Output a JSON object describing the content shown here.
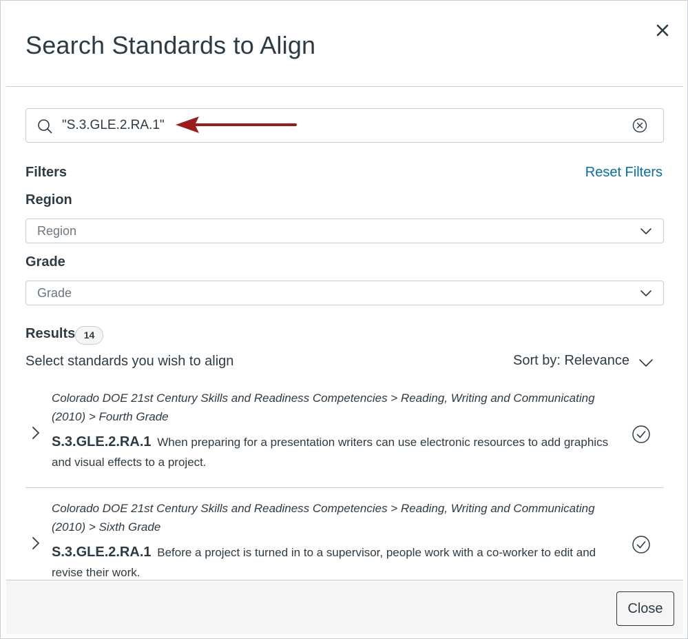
{
  "modal": {
    "title": "Search Standards to Align",
    "close_icon": "close-icon"
  },
  "search": {
    "value": "\"S.3.GLE.2.RA.1\"",
    "icon": "search-icon",
    "clear_icon": "clear-circle-icon"
  },
  "annotation": {
    "arrow_color": "#9b1c1c"
  },
  "filters": {
    "label": "Filters",
    "reset_label": "Reset Filters",
    "region": {
      "label": "Region",
      "placeholder": "Region"
    },
    "grade": {
      "label": "Grade",
      "placeholder": "Grade"
    }
  },
  "results": {
    "label": "Results",
    "count": "14",
    "hint": "Select standards you wish to align",
    "sort_label": "Sort by: Relevance",
    "items": [
      {
        "path": "Colorado DOE 21st Century Skills and Readiness Competencies > Reading, Writing and Communicating (2010) > Fourth Grade",
        "code": "S.3.GLE.2.RA.1",
        "description": "When preparing for a presentation writers can use electronic resources to add graphics and visual effects to a project."
      },
      {
        "path": "Colorado DOE 21st Century Skills and Readiness Competencies > Reading, Writing and Communicating (2010) > Sixth Grade",
        "code": "S.3.GLE.2.RA.1",
        "description": "Before a project is turned in to a supervisor, people work with a co-worker to edit and revise their work."
      }
    ]
  },
  "footer": {
    "close_label": "Close"
  },
  "colors": {
    "link": "#0770a3",
    "text": "#2d3b45",
    "border": "#c7cdd1",
    "footer_bg": "#f5f5f5"
  }
}
